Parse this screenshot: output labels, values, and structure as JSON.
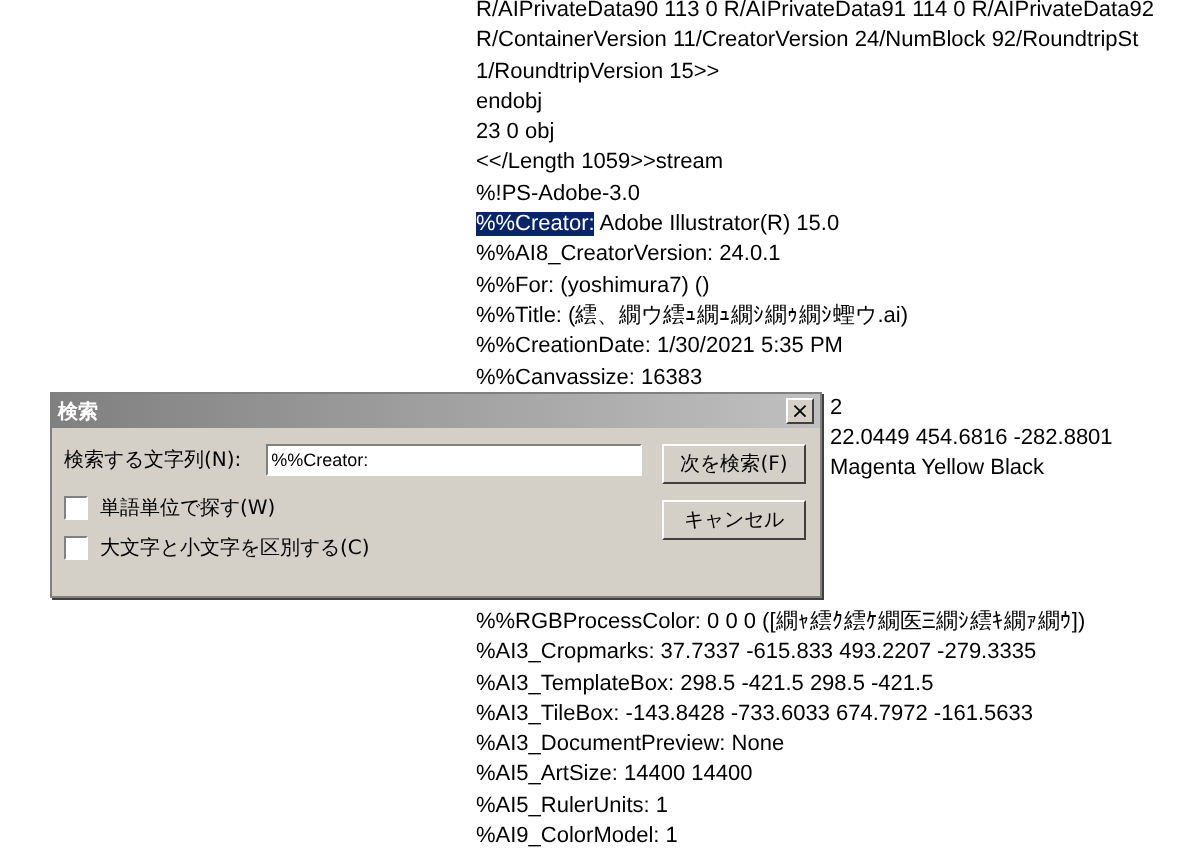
{
  "code_lines": [
    {
      "kind": "full",
      "text": "R/AIPrivateData90 113 0 R/AIPrivateData91 114 0 R/AIPrivateData92"
    },
    {
      "kind": "full",
      "text": "R/ContainerVersion 11/CreatorVersion 24/NumBlock 92/RoundtripSt"
    },
    {
      "kind": "full",
      "text": "1/RoundtripVersion 15>>"
    },
    {
      "kind": "full",
      "text": "endobj"
    },
    {
      "kind": "full",
      "text": "23 0 obj"
    },
    {
      "kind": "full",
      "text": "<</Length 1059>>stream"
    },
    {
      "kind": "full",
      "text": "%!PS-Adobe-3.0"
    },
    {
      "kind": "highlight",
      "highlight": "%%Creator:",
      "text": " Adobe Illustrator(R) 15.0"
    },
    {
      "kind": "full",
      "text": "%%AI8_CreatorVersion: 24.0.1"
    },
    {
      "kind": "full",
      "text": "%%For: (yoshimura7) ()"
    },
    {
      "kind": "full",
      "text": "%%Title: (繧、繝ウ繧ｭ繝ｭ繝ｼ繝ｩ繝ｼ蟶ウ.ai)"
    },
    {
      "kind": "full",
      "text": "%%CreationDate: 1/30/2021 5:35 PM"
    },
    {
      "kind": "full",
      "text": "%%Canvassize: 16383"
    },
    {
      "kind": "tail",
      "text": "2"
    },
    {
      "kind": "tail",
      "text": "22.0449 454.6816 -282.8801"
    },
    {
      "kind": "tail",
      "text": "Magenta Yellow Black"
    },
    {
      "kind": "after_gap",
      "text": "%%RGBProcessColor: 0 0 0 ([繝ｬ繧ｸ繧ｹ繝医Ξ繝ｼ繧ｷ繝ｧ繝ｳ])"
    },
    {
      "kind": "full",
      "text": "%AI3_Cropmarks: 37.7337 -615.833 493.2207 -279.3335"
    },
    {
      "kind": "full",
      "text": "%AI3_TemplateBox: 298.5 -421.5 298.5 -421.5"
    },
    {
      "kind": "full",
      "text": "%AI3_TileBox: -143.8428 -733.6033 674.7972 -161.5633"
    },
    {
      "kind": "full",
      "text": "%AI3_DocumentPreview: None"
    },
    {
      "kind": "full",
      "text": "%AI5_ArtSize: 14400 14400"
    },
    {
      "kind": "full",
      "text": "%AI5_RulerUnits: 1"
    },
    {
      "kind": "full",
      "text": "%AI9_ColorModel: 1"
    }
  ],
  "dialog": {
    "title": "検索",
    "close": "×",
    "search_label": "検索する文字列(N):",
    "search_value": "%%Creator:",
    "options": [
      {
        "label": "単語単位で探す(W)",
        "checked": false
      },
      {
        "label": "大文字と小文字を区別する(C)",
        "checked": false
      }
    ],
    "buttons": [
      "次を検索(F)",
      "キャンセル"
    ]
  }
}
